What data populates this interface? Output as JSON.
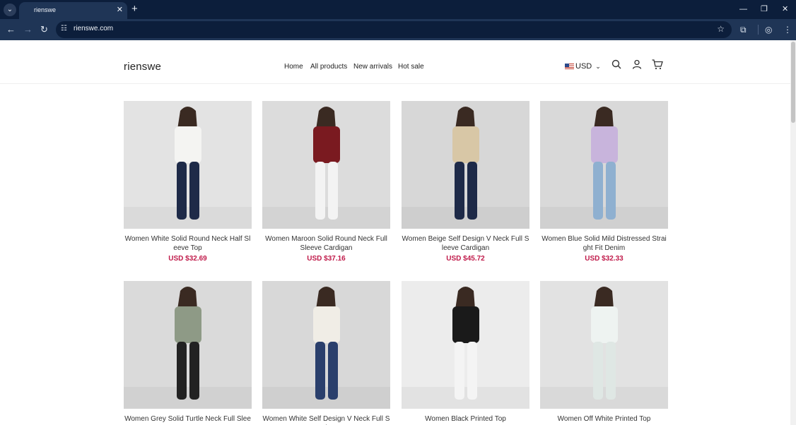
{
  "browser": {
    "tab_title": "rienswe",
    "url": "rienswe.com"
  },
  "store": {
    "logo": "rienswe",
    "nav": [
      "Home",
      "All products",
      "New arrivals",
      "Hot sale"
    ],
    "currency": "USD"
  },
  "products": [
    {
      "title": "Women White Solid Round Neck Half Sleeve Top",
      "price": "USD $32.69",
      "bg": "#e3e3e3",
      "top": "#f4f4f2",
      "bottom": "#1e2a48"
    },
    {
      "title": "Women Maroon Solid Round Neck Full Sleeve Cardigan",
      "price": "USD $37.16",
      "bg": "#dcdcdc",
      "top": "#7a1a20",
      "bottom": "#f3f3f3"
    },
    {
      "title": "Women Beige Self Design V Neck Full Sleeve Cardigan",
      "price": "USD $45.72",
      "bg": "#d7d7d7",
      "top": "#d8c7a6",
      "bottom": "#1e2a48"
    },
    {
      "title": "Women Blue Solid Mild Distressed Straight Fit Denim",
      "price": "USD $32.33",
      "bg": "#d9d9d9",
      "top": "#c8b4dc",
      "bottom": "#8fb0d0"
    },
    {
      "title": "Women Grey Solid Turtle Neck Full Slee",
      "price": "",
      "bg": "#dadada",
      "top": "#8e9a86",
      "bottom": "#222222"
    },
    {
      "title": "Women White Self Design V Neck Full Sl",
      "price": "",
      "bg": "#d8d8d8",
      "top": "#f0ede6",
      "bottom": "#2a3f6c"
    },
    {
      "title": "Women Black Printed Top",
      "price": "",
      "bg": "#ececec",
      "top": "#1a1a1a",
      "bottom": "#f4f4f4"
    },
    {
      "title": "Women Off White Printed Top",
      "price": "",
      "bg": "#e2e2e2",
      "top": "#eef3f1",
      "bottom": "#dfe7e4"
    }
  ]
}
